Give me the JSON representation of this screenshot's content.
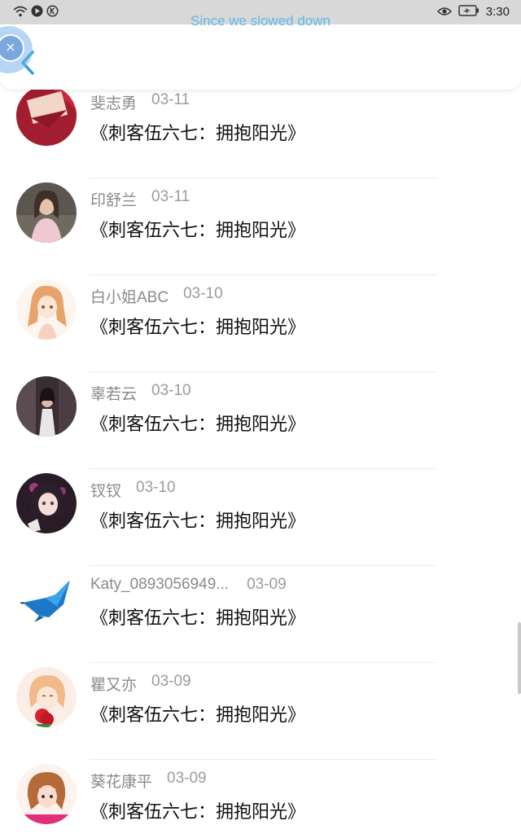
{
  "status_bar": {
    "time": "3:30",
    "left_icons": [
      "wifi-icon",
      "play-icon",
      "k-icon"
    ],
    "right_icons": [
      "eye-icon",
      "battery-charging-icon"
    ]
  },
  "overlay_text": "Since we slowed down",
  "header": {
    "back_icon": "chevron-left-icon",
    "accent_color": "#2e9bd6"
  },
  "floating_button": {
    "icon": "close-icon"
  },
  "list": {
    "items": [
      {
        "name": "斐志勇",
        "date": "03-11",
        "title": "《刺客伍六七：拥抱阳光》"
      },
      {
        "name": "印舒兰",
        "date": "03-11",
        "title": "《刺客伍六七：拥抱阳光》"
      },
      {
        "name": "白小姐ABC",
        "date": "03-10",
        "title": "《刺客伍六七：拥抱阳光》"
      },
      {
        "name": "辜若云",
        "date": "03-10",
        "title": "《刺客伍六七：拥抱阳光》"
      },
      {
        "name": "钗钗",
        "date": "03-10",
        "title": "《刺客伍六七：拥抱阳光》"
      },
      {
        "name": "Katy_0893056949...",
        "date": "03-09",
        "title": "《刺客伍六七：拥抱阳光》"
      },
      {
        "name": "瞿又亦",
        "date": "03-09",
        "title": "《刺客伍六七：拥抱阳光》"
      },
      {
        "name": "葵花康平",
        "date": "03-09",
        "title": "《刺客伍六七：拥抱阳光》"
      }
    ]
  }
}
